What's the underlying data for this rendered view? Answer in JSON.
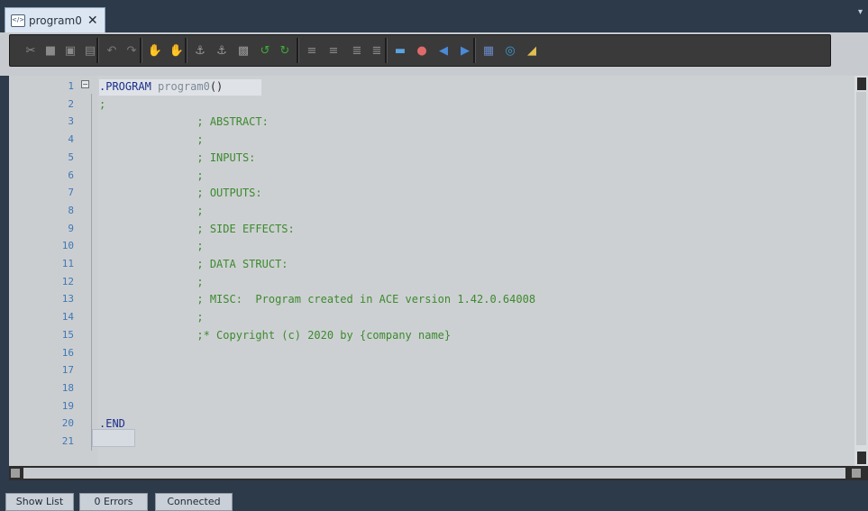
{
  "tab": {
    "title": "program0",
    "icon": "code-file-icon",
    "close_glyph": "✕",
    "icon_glyph": "</>"
  },
  "window_menu_glyph": "▾",
  "toolbar": {
    "buttons": [
      {
        "name": "cut-icon",
        "glyph": "✂"
      },
      {
        "name": "copy-icon",
        "glyph": "■"
      },
      {
        "name": "paste-icon",
        "glyph": "▣"
      },
      {
        "name": "delete-icon",
        "glyph": "▤"
      },
      {
        "name": "undo-icon",
        "glyph": "↶"
      },
      {
        "name": "redo-icon",
        "glyph": "↷"
      },
      {
        "name": "hand-icon",
        "glyph": "✋"
      },
      {
        "name": "hand-red-icon",
        "glyph": "✋"
      },
      {
        "name": "step-into-icon",
        "glyph": "⚓"
      },
      {
        "name": "step-over-icon",
        "glyph": "⚓"
      },
      {
        "name": "run-to-cursor-icon",
        "glyph": "▩"
      },
      {
        "name": "jump-back-icon",
        "glyph": "↺"
      },
      {
        "name": "jump-forward-icon",
        "glyph": "↻"
      },
      {
        "name": "outdent-icon",
        "glyph": "≡"
      },
      {
        "name": "indent-icon",
        "glyph": "≡"
      },
      {
        "name": "comment-icon",
        "glyph": "≣"
      },
      {
        "name": "uncomment-icon",
        "glyph": "≣"
      },
      {
        "name": "bookmark-icon",
        "glyph": "▬"
      },
      {
        "name": "bookmark-toggle-icon",
        "glyph": "●"
      },
      {
        "name": "bookmark-prev-icon",
        "glyph": "◀"
      },
      {
        "name": "bookmark-next-icon",
        "glyph": "▶"
      },
      {
        "name": "format-icon",
        "glyph": "▦"
      },
      {
        "name": "find-icon",
        "glyph": "◎"
      },
      {
        "name": "goto-icon",
        "glyph": "◢"
      }
    ]
  },
  "colors": {
    "keyword": "#1c2e8c",
    "comment": "#3c8a2d",
    "identifier": "#7e8a96",
    "line_number": "#3e78b5",
    "editor_bg": "#cdd0d3"
  },
  "editor": {
    "lines": [
      {
        "n": "1",
        "segments": [
          {
            "t": ".PROGRAM ",
            "c": "kw"
          },
          {
            "t": "program0",
            "c": "ident"
          },
          {
            "t": "()",
            "c": "pn"
          }
        ]
      },
      {
        "n": "2",
        "segments": [
          {
            "t": ";",
            "c": "cm"
          }
        ]
      },
      {
        "n": "3",
        "segments": [
          {
            "t": "               ; ABSTRACT:",
            "c": "cm"
          }
        ]
      },
      {
        "n": "4",
        "segments": [
          {
            "t": "               ;",
            "c": "cm"
          }
        ]
      },
      {
        "n": "5",
        "segments": [
          {
            "t": "               ; INPUTS:",
            "c": "cm"
          }
        ]
      },
      {
        "n": "6",
        "segments": [
          {
            "t": "               ;",
            "c": "cm"
          }
        ]
      },
      {
        "n": "7",
        "segments": [
          {
            "t": "               ; OUTPUTS:",
            "c": "cm"
          }
        ]
      },
      {
        "n": "8",
        "segments": [
          {
            "t": "               ;",
            "c": "cm"
          }
        ]
      },
      {
        "n": "9",
        "segments": [
          {
            "t": "               ; SIDE EFFECTS:",
            "c": "cm"
          }
        ]
      },
      {
        "n": "10",
        "segments": [
          {
            "t": "               ;",
            "c": "cm"
          }
        ]
      },
      {
        "n": "11",
        "segments": [
          {
            "t": "               ; DATA STRUCT:",
            "c": "cm"
          }
        ]
      },
      {
        "n": "12",
        "segments": [
          {
            "t": "               ;",
            "c": "cm"
          }
        ]
      },
      {
        "n": "13",
        "segments": [
          {
            "t": "               ; MISC:  Program created in ACE version 1.42.0.64008",
            "c": "cm"
          }
        ]
      },
      {
        "n": "14",
        "segments": [
          {
            "t": "               ;",
            "c": "cm"
          }
        ]
      },
      {
        "n": "15",
        "segments": [
          {
            "t": "               ;* Copyright (c) 2020 by {company name}",
            "c": "cm"
          }
        ]
      },
      {
        "n": "16",
        "segments": []
      },
      {
        "n": "17",
        "segments": []
      },
      {
        "n": "18",
        "segments": []
      },
      {
        "n": "19",
        "segments": []
      },
      {
        "n": "20",
        "segments": [
          {
            "t": ".END",
            "c": "kw"
          }
        ]
      },
      {
        "n": "21",
        "segments": []
      }
    ],
    "fold_glyph": "−"
  },
  "statusbar": {
    "show_list": "Show List",
    "errors": "0 Errors",
    "connection": "Connected"
  }
}
